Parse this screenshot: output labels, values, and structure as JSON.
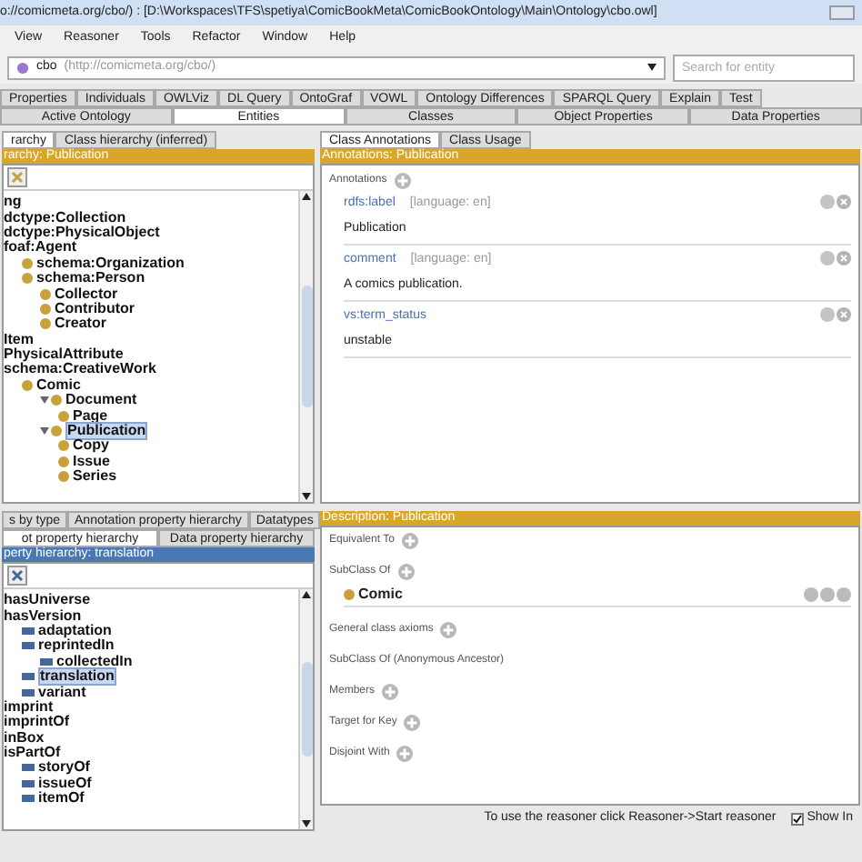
{
  "window": {
    "title": "o://comicmeta.org/cbo/) : [D:\\Workspaces\\TFS\\spetiya\\ComicBookMeta\\ComicBookOntology\\Main\\Ontology\\cbo.owl]"
  },
  "menu": [
    "View",
    "Reasoner",
    "Tools",
    "Refactor",
    "Window",
    "Help"
  ],
  "ontology_selector": {
    "name": "cbo",
    "iri": "(http://comicmeta.org/cbo/)"
  },
  "search": {
    "placeholder": "Search for entity"
  },
  "tabs": [
    {
      "label": "Properties",
      "selected": false
    },
    {
      "label": "Individuals",
      "selected": false
    },
    {
      "label": "OWLViz",
      "selected": false
    },
    {
      "label": "DL Query",
      "selected": false
    },
    {
      "label": "OntoGraf",
      "selected": false
    },
    {
      "label": "VOWL",
      "selected": false
    },
    {
      "label": "Ontology Differences",
      "selected": false
    },
    {
      "label": "SPARQL Query",
      "selected": false
    },
    {
      "label": "Explain",
      "selected": false
    },
    {
      "label": "Test",
      "selected": false
    }
  ],
  "subtabs": [
    {
      "label": "Active Ontology",
      "selected": false
    },
    {
      "label": "Entities",
      "selected": true
    },
    {
      "label": "Classes",
      "selected": false
    },
    {
      "label": "Object Properties",
      "selected": false
    },
    {
      "label": "Data Properties",
      "selected": false
    }
  ],
  "class_panel": {
    "tabs": [
      {
        "label": "rarchy",
        "selected": true
      },
      {
        "label": "Class hierarchy (inferred)",
        "selected": false
      }
    ],
    "header": "rarchy: Publication",
    "tree": [
      {
        "label": "ng",
        "selected": false
      },
      {
        "label": "dctype:Collection",
        "selected": false
      },
      {
        "label": "dctype:PhysicalObject",
        "selected": false
      },
      {
        "label": "foaf:Agent",
        "selected": false,
        "children": [
          {
            "label": "schema:Organization",
            "selected": false
          },
          {
            "label": "schema:Person",
            "selected": false,
            "children": [
              {
                "label": "Collector",
                "selected": false
              },
              {
                "label": "Contributor",
                "selected": false
              },
              {
                "label": "Creator",
                "selected": false
              }
            ]
          }
        ]
      },
      {
        "label": "Item",
        "selected": false
      },
      {
        "label": "PhysicalAttribute",
        "selected": false
      },
      {
        "label": "schema:CreativeWork",
        "selected": false,
        "children": [
          {
            "label": "Comic",
            "selected": false,
            "children": [
              {
                "label": "Document",
                "selected": false,
                "children": [
                  {
                    "label": "Page",
                    "selected": false
                  }
                ]
              },
              {
                "label": "Publication",
                "selected": true,
                "children": [
                  {
                    "label": "Copy",
                    "selected": false
                  },
                  {
                    "label": "Issue",
                    "selected": false
                  },
                  {
                    "label": "Series",
                    "selected": false
                  }
                ]
              }
            ]
          }
        ]
      }
    ]
  },
  "annotations_panel": {
    "tabs": [
      {
        "label": "Class Annotations",
        "selected": true
      },
      {
        "label": "Class Usage",
        "selected": false
      }
    ],
    "header": "Annotations: Publication",
    "label": "Annotations",
    "items": [
      {
        "property": "rdfs:label",
        "language": "[language: en]",
        "value": "Publication"
      },
      {
        "property": "comment",
        "language": "[language: en]",
        "value": "A comics publication."
      },
      {
        "property": "vs:term_status",
        "value": "unstable"
      }
    ]
  },
  "property_panel": {
    "tabs_top": [
      {
        "label": "s by type",
        "selected": false
      },
      {
        "label": "Annotation property hierarchy",
        "selected": false
      },
      {
        "label": "Datatypes",
        "selected": false
      }
    ],
    "tabs": [
      {
        "label": "ot property hierarchy",
        "selected": true
      },
      {
        "label": "Data property hierarchy",
        "selected": false
      }
    ],
    "header": "perty hierarchy: translation",
    "tree": [
      {
        "label": "hasUniverse",
        "selected": false
      },
      {
        "label": "hasVersion",
        "selected": false,
        "children": [
          {
            "label": "adaptation",
            "selected": false
          },
          {
            "label": "reprintedIn",
            "selected": false,
            "children": [
              {
                "label": "collectedIn",
                "selected": false
              }
            ]
          },
          {
            "label": "translation",
            "selected": true
          },
          {
            "label": "variant",
            "selected": false
          }
        ]
      },
      {
        "label": "imprint",
        "selected": false
      },
      {
        "label": "imprintOf",
        "selected": false
      },
      {
        "label": "inBox",
        "selected": false
      },
      {
        "label": "isPartOf",
        "selected": false,
        "children": [
          {
            "label": "storyOf",
            "selected": false
          },
          {
            "label": "issueOf",
            "selected": false
          },
          {
            "label": "itemOf",
            "selected": false
          }
        ]
      }
    ]
  },
  "description_panel": {
    "header": "Description: Publication",
    "sections": [
      {
        "label": "Equivalent To",
        "addable": true
      },
      {
        "label": "SubClass Of",
        "addable": true,
        "items": [
          "Comic"
        ]
      },
      {
        "label": "General class axioms",
        "addable": true
      },
      {
        "label": "SubClass Of (Anonymous Ancestor)",
        "addable": false
      },
      {
        "label": "Members",
        "addable": true
      },
      {
        "label": "Target for Key",
        "addable": true
      },
      {
        "label": "Disjoint With",
        "addable": true
      }
    ]
  },
  "status_bar": {
    "message": "To use the reasoner click Reasoner->Start reasoner",
    "checkbox": {
      "label": "Show In",
      "checked": true
    }
  }
}
